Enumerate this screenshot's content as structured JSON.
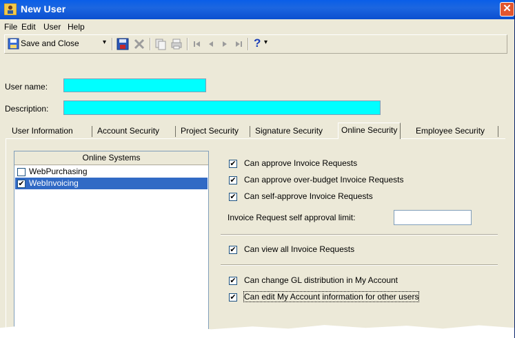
{
  "window": {
    "title": "New User",
    "close_glyph": "✕"
  },
  "menu": [
    "File",
    "Edit",
    "User",
    "Help"
  ],
  "toolbar": {
    "save_close_label": "Save and Close",
    "dropdown_glyph": "▾",
    "help_glyph": "?",
    "icons": [
      "save-icon",
      "delete-icon",
      "copy-icon",
      "print-icon",
      "first-record-icon",
      "previous-record-icon",
      "next-record-icon",
      "last-record-icon",
      "help-icon"
    ]
  },
  "form": {
    "user_name_label": "User name:",
    "user_name_value": "",
    "description_label": "Description:",
    "description_value": ""
  },
  "tabs": [
    {
      "label": "User Information"
    },
    {
      "label": "Account Security"
    },
    {
      "label": "Project Security"
    },
    {
      "label": "Signature Security"
    },
    {
      "label": "Online Security"
    },
    {
      "label": "Employee Security"
    }
  ],
  "active_tab": "Online Security",
  "online_systems": {
    "header": "Online Systems",
    "items": [
      {
        "label": "WebPurchasing",
        "checked": false,
        "selected": false
      },
      {
        "label": "WebInvoicing",
        "checked": true,
        "selected": true
      }
    ]
  },
  "options": {
    "approve": "Can approve Invoice Requests",
    "approve_over_budget": "Can approve over-budget Invoice Requests",
    "self_approve": "Can self-approve Invoice Requests",
    "self_limit_label": "Invoice Request self approval limit:",
    "self_limit_value": "",
    "view_all": "Can view all Invoice Requests",
    "change_gl": "Can change GL distribution in My Account",
    "edit_others": "Can edit My Account information for other users",
    "check_glyph": "✔"
  },
  "colors": {
    "title_bar": "#0a5ee8",
    "highlight": "#316ac5",
    "required_field": "#00ffff",
    "chrome": "#ece9d8"
  }
}
